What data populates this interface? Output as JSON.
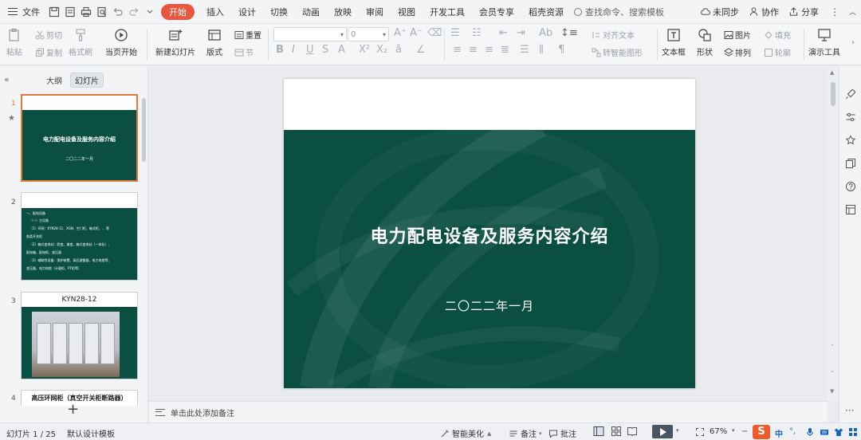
{
  "menubar": {
    "file": "文件",
    "tabs": [
      "开始",
      "插入",
      "设计",
      "切换",
      "动画",
      "放映",
      "审阅",
      "视图",
      "开发工具",
      "会员专享",
      "稻壳资源"
    ],
    "search_placeholder": "查找命令、搜索模板",
    "sync": "未同步",
    "collab": "协作",
    "share": "分享"
  },
  "ribbon": {
    "paste": "粘贴",
    "cut": "剪切",
    "copy": "复制",
    "format_painter": "格式刷",
    "play_from_current": "当页开始",
    "new_slide": "新建幻灯片",
    "layout": "版式",
    "section": "节",
    "reset": "重置",
    "font_size": "0",
    "align_text": "对齐文本",
    "smart_graphic": "转智能图形",
    "text_box": "文本框",
    "shapes": "形状",
    "picture": "图片",
    "arrange": "排列",
    "fill": "填充",
    "outline": "轮廓",
    "presentation_tools": "演示工具"
  },
  "left_panel": {
    "tab_outline": "大纲",
    "tab_slides": "幻灯片",
    "thumbnails": [
      {
        "num": "1",
        "title": "电力配电设备及服务内容介绍",
        "date": "二〇二二年一月"
      },
      {
        "num": "2",
        "lines": [
          "一、配电设备",
          "（一）主设备",
          "（1）环网：KYN28-12、XGN、空门柜、箱式柜、... 等",
          "各类开关柜",
          "（2）箱式变电站：欧变、美变、箱式变电站（一体化）、",
          "配电箱、配电柜、变压器",
          "（3）辅助性设备：保护装置、高压避雷器、电力电缆等、",
          "变压器、电力电缆（计量柜、PT柜等）"
        ]
      },
      {
        "num": "3",
        "title": "KYN28-12"
      },
      {
        "num": "4",
        "title": "高压环网柜（真空开关柜断路器）"
      }
    ]
  },
  "slide": {
    "title": "电力配电设备及服务内容介绍",
    "date": "二〇二二年一月"
  },
  "notes": {
    "placeholder": "单击此处添加备注"
  },
  "statusbar": {
    "slide_counter": "幻灯片 1 / 25",
    "template": "默认设计模板",
    "beautify": "智能美化",
    "notes": "备注",
    "comments": "批注",
    "zoom": "67%",
    "ime_label": "中"
  },
  "colors": {
    "accent": "#e8573d",
    "slide_green": "#0b4f43",
    "selection": "#e07a3c"
  }
}
